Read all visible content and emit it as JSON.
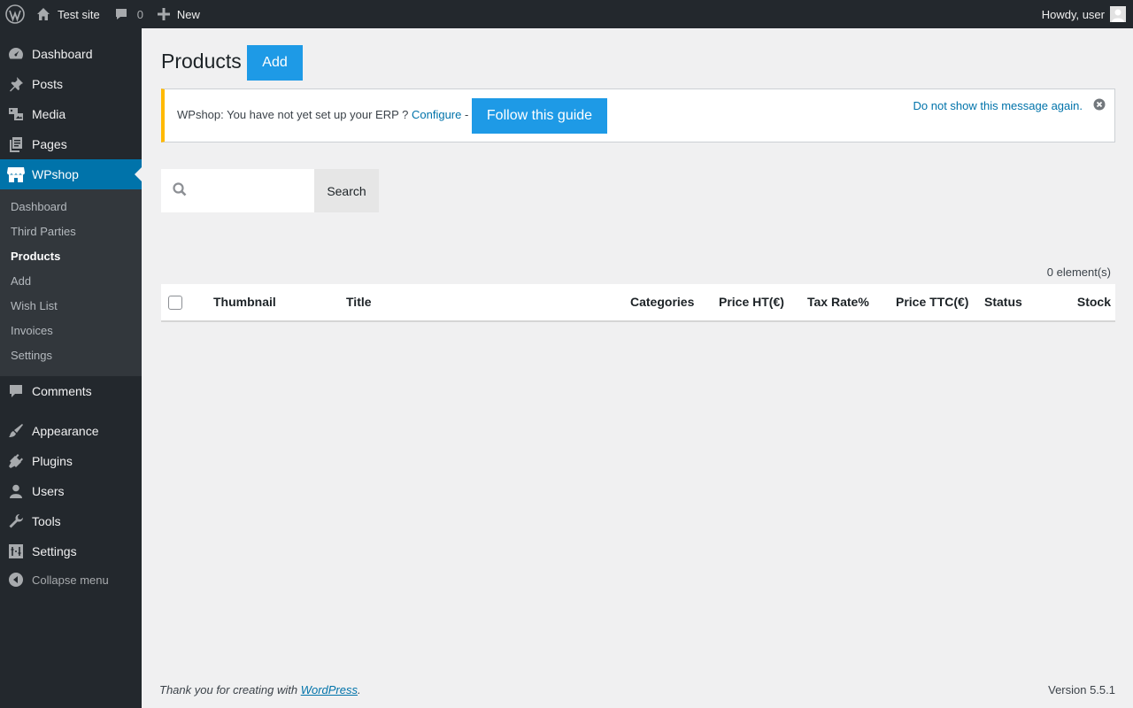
{
  "adminbar": {
    "site_name": "Test site",
    "comments_count": "0",
    "new_label": "New",
    "greeting": "Howdy, user"
  },
  "menu": {
    "items": [
      {
        "label": "Dashboard",
        "icon": "dashboard-icon"
      },
      {
        "label": "Posts",
        "icon": "pin-icon"
      },
      {
        "label": "Media",
        "icon": "media-icon"
      },
      {
        "label": "Pages",
        "icon": "pages-icon"
      },
      {
        "label": "WPshop",
        "icon": "store-icon"
      },
      {
        "label": "Comments",
        "icon": "comment-icon"
      },
      {
        "label": "Appearance",
        "icon": "brush-icon"
      },
      {
        "label": "Plugins",
        "icon": "plugin-icon"
      },
      {
        "label": "Users",
        "icon": "user-icon"
      },
      {
        "label": "Tools",
        "icon": "wrench-icon"
      },
      {
        "label": "Settings",
        "icon": "settings-icon"
      }
    ],
    "submenu": [
      "Dashboard",
      "Third Parties",
      "Products",
      "Add",
      "Wish List",
      "Invoices",
      "Settings"
    ],
    "collapse_label": "Collapse menu"
  },
  "page": {
    "title": "Products",
    "add_button": "Add"
  },
  "notice": {
    "text": "WPshop: You have not yet set up your ERP ?",
    "configure_link": "Configure",
    "separator": "-",
    "guide_button": "Follow this guide",
    "dismiss_link": "Do not show this message again."
  },
  "search": {
    "button_label": "Search",
    "value": ""
  },
  "table": {
    "count_label": "0 element(s)",
    "columns": [
      "Thumbnail",
      "Title",
      "Categories",
      "Price HT(€)",
      "Tax Rate%",
      "Price TTC(€)",
      "Status",
      "Stock"
    ]
  },
  "footer": {
    "thanks_prefix": "Thank you for creating with",
    "wordpress_link": "WordPress",
    "thanks_suffix": ".",
    "version": "Version 5.5.1"
  },
  "colors": {
    "adminbar_bg": "#23282d",
    "menu_current": "#0073aa",
    "button_blue": "#1e9ae6",
    "notice_accent": "#ffb900",
    "link": "#0073aa"
  }
}
